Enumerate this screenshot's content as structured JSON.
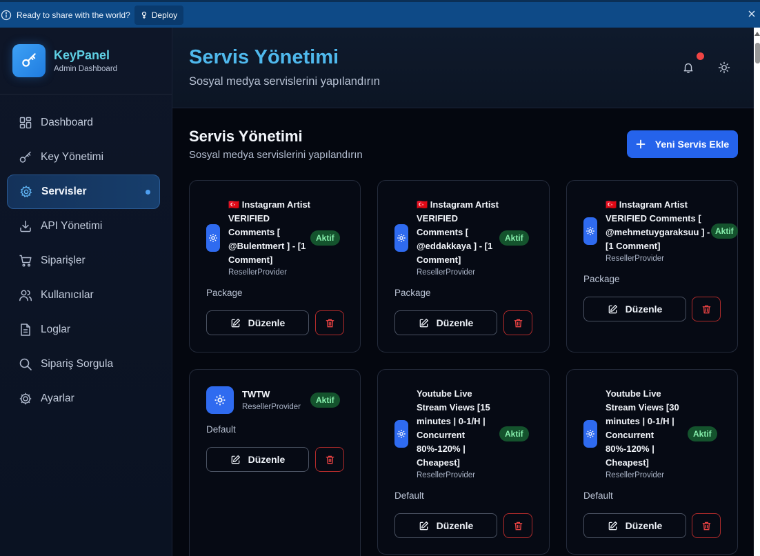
{
  "banner": {
    "message": "Ready to share with the world?",
    "deploy_label": "Deploy"
  },
  "brand": {
    "title": "KeyPanel",
    "subtitle": "Admin Dashboard"
  },
  "sidebar": {
    "items": [
      {
        "label": "Dashboard",
        "icon": "grid-icon"
      },
      {
        "label": "Key Yönetimi",
        "icon": "key-icon"
      },
      {
        "label": "Servisler",
        "icon": "gear-icon",
        "active": true
      },
      {
        "label": "API Yönetimi",
        "icon": "download-icon"
      },
      {
        "label": "Siparişler",
        "icon": "cart-icon"
      },
      {
        "label": "Kullanıcılar",
        "icon": "users-icon"
      },
      {
        "label": "Loglar",
        "icon": "file-icon"
      },
      {
        "label": "Sipariş Sorgula",
        "icon": "search-icon"
      },
      {
        "label": "Ayarlar",
        "icon": "settings-icon"
      }
    ]
  },
  "header": {
    "title": "Servis Yönetimi",
    "subtitle": "Sosyal medya servislerini yapılandırın"
  },
  "main": {
    "title": "Servis Yönetimi",
    "subtitle": "Sosyal medya servislerini yapılandırın",
    "add_button": "Yeni Servis Ekle"
  },
  "services": [
    {
      "lines": [
        "🇹🇷 Instagram Artist",
        "VERIFIED",
        "Comments [",
        "@Bulentmert ] - [1",
        "Comment]"
      ],
      "provider": "ResellerProvider",
      "status": "Aktif",
      "package": "Package",
      "edit_label": "Düzenle"
    },
    {
      "lines": [
        "🇹🇷 Instagram Artist",
        "VERIFIED",
        "Comments [",
        "@eddakkaya ] - [1",
        "Comment]"
      ],
      "provider": "ResellerProvider",
      "status": "Aktif",
      "package": "Package",
      "edit_label": "Düzenle"
    },
    {
      "lines": [
        "🇹🇷 Instagram Artist",
        "VERIFIED Comments [",
        "@mehmetuygaraksuu ] -",
        "[1 Comment]"
      ],
      "provider": "ResellerProvider",
      "status": "Aktif",
      "package": "Package",
      "edit_label": "Düzenle"
    },
    {
      "lines": [
        "TWTW"
      ],
      "provider": "ResellerProvider",
      "status": "Aktif",
      "package": "Default",
      "edit_label": "Düzenle"
    },
    {
      "lines": [
        "Youtube Live",
        "Stream Views [15",
        "minutes | 0-1/H |",
        "Concurrent",
        "80%-120% |",
        "Cheapest]"
      ],
      "provider": "ResellerProvider",
      "status": "Aktif",
      "package": "Default",
      "edit_label": "Düzenle"
    },
    {
      "lines": [
        "Youtube Live",
        "Stream Views [30",
        "minutes | 0-1/H |",
        "Concurrent",
        "80%-120% |",
        "Cheapest]"
      ],
      "provider": "ResellerProvider",
      "status": "Aktif",
      "package": "Default",
      "edit_label": "Düzenle"
    }
  ],
  "colors": {
    "accent": "#2563eb",
    "active_badge_bg": "#14532d",
    "active_badge_text": "#86efac",
    "danger": "#ef4444",
    "brand_title": "#5fd0e4"
  }
}
